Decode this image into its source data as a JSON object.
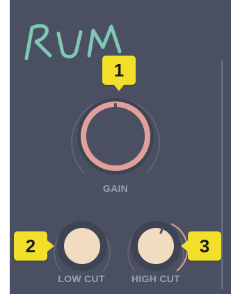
{
  "plugin": {
    "logo_text": "RUM",
    "colors": {
      "panel": "#4a5061",
      "gain_ring": "#e3a09b",
      "cut_knob": "#f1dcc0",
      "callout": "#f2df2a",
      "label": "#9aa0ad"
    }
  },
  "controls": {
    "gain": {
      "label": "GAIN",
      "callout": "1"
    },
    "low_cut": {
      "label": "LOW CUT",
      "callout": "2"
    },
    "high_cut": {
      "label": "HIGH CUT",
      "callout": "3"
    }
  }
}
